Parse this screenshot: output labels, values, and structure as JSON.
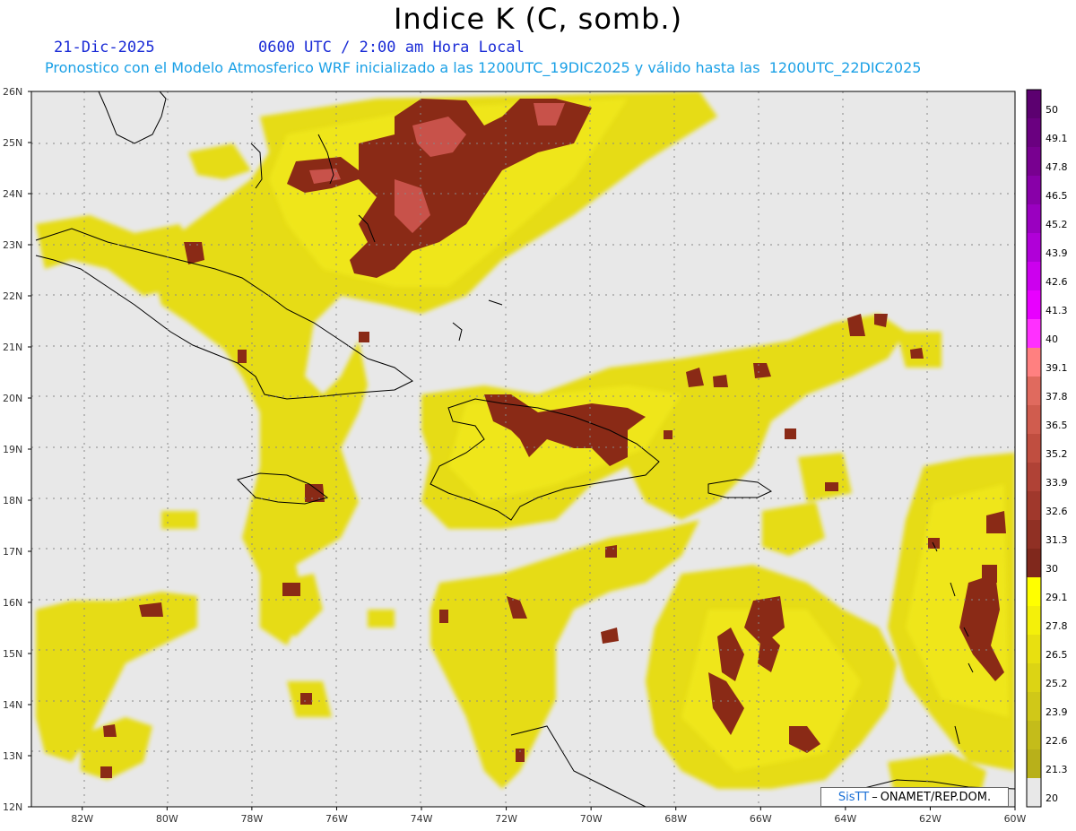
{
  "header": {
    "title": "Indice K (C, somb.)",
    "date": "21-Dic-2025",
    "time": "0600 UTC / 2:00 am Hora Local",
    "forecast": "Pronostico con el Modelo Atmosferico WRF inicializado a las 1200UTC_19DIC2025 y válido hasta las  1200UTC_22DIC2025"
  },
  "map": {
    "lat_labels": [
      "26N",
      "25N",
      "24N",
      "23N",
      "22N",
      "21N",
      "20N",
      "19N",
      "18N",
      "17N",
      "16N",
      "15N",
      "14N",
      "13N",
      "12N"
    ],
    "lon_labels": [
      "82W",
      "80W",
      "78W",
      "76W",
      "74W",
      "72W",
      "70W",
      "68W",
      "66W",
      "64W",
      "62W",
      "60W"
    ],
    "lat_range": [
      12,
      26
    ],
    "lon_range": [
      -83.2,
      -60
    ],
    "background_color": "#e6e6e6",
    "gridlines": "dotted"
  },
  "colorbar": {
    "labels": [
      "50",
      "49.1",
      "47.8",
      "46.5",
      "45.2",
      "43.9",
      "42.6",
      "41.3",
      "40",
      "39.1",
      "37.8",
      "36.5",
      "35.2",
      "33.9",
      "32.6",
      "31.3",
      "30",
      "29.1",
      "27.8",
      "26.5",
      "25.2",
      "23.9",
      "22.6",
      "21.3",
      "20"
    ],
    "colors": [
      "#5c0070",
      "#6a0080",
      "#780090",
      "#8800a8",
      "#9a00c0",
      "#b000d8",
      "#cc00ee",
      "#e800ff",
      "#ff30ff",
      "#ff8080",
      "#e06a5e",
      "#d05c4e",
      "#c04e40",
      "#b04236",
      "#a0382c",
      "#903024",
      "#80281c",
      "#ffff00",
      "#f4f00a",
      "#e8e010",
      "#dcd414",
      "#d0c818",
      "#c4bc1a",
      "#b8b01a",
      "#e8e8e8"
    ]
  },
  "credit": {
    "brand": "SisTT",
    "text": "ONAMET/REP.DOM."
  }
}
